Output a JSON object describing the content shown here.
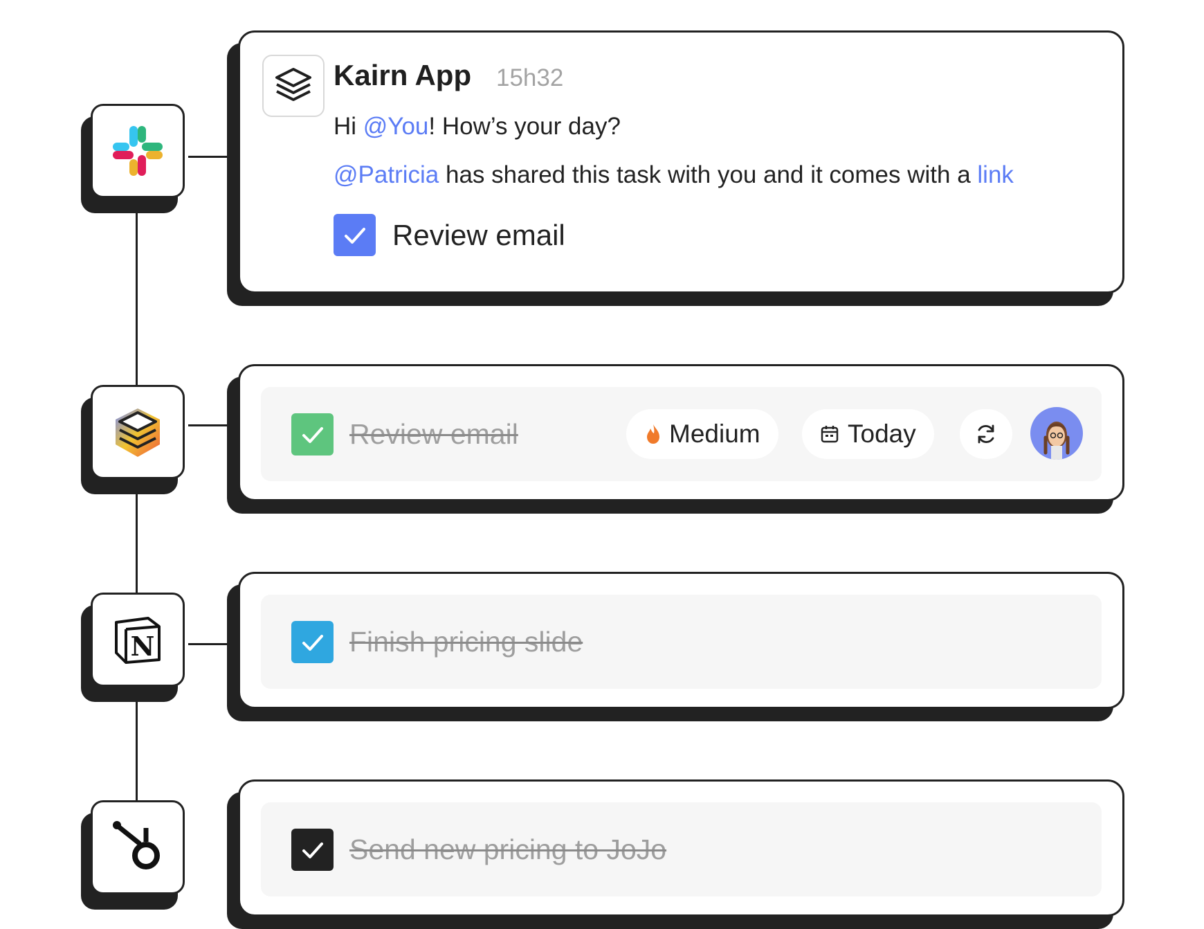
{
  "message": {
    "app_name": "Kairn App",
    "time": "15h32",
    "greeting_prefix": "Hi ",
    "greeting_mention": "@You",
    "greeting_suffix": "! How’s your day?",
    "share_mention": "@Patricia",
    "share_text": " has shared this task with you and it comes with a ",
    "share_link": "link",
    "task_label": "Review email",
    "task_checked": true
  },
  "tasks": [
    {
      "label": "Review email",
      "completed": true,
      "checkbox_color": "#5ec57e",
      "priority": "Medium",
      "due": "Today"
    },
    {
      "label": "Finish pricing slide",
      "completed": true,
      "checkbox_color": "#2fa7e0"
    },
    {
      "label": "Send new pricing to JoJo",
      "completed": true,
      "checkbox_color": "#222222"
    }
  ],
  "integrations": [
    "slack-icon",
    "kairn-icon",
    "notion-icon",
    "hubspot-icon"
  ],
  "colors": {
    "mention": "#5b7cf5",
    "message_checkbox": "#5b7cf5",
    "border": "#222222"
  }
}
